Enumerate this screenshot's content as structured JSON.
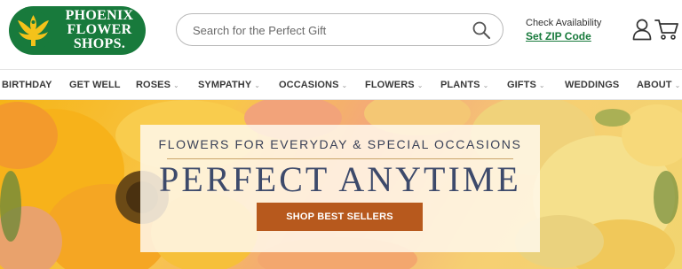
{
  "brand": {
    "logo_line1": "PHOENIX",
    "logo_line2": "FLOWER",
    "logo_line3": "SHOPS.",
    "green": "#187a3c"
  },
  "search": {
    "placeholder": "Search for the Perfect Gift",
    "icon": "search-icon"
  },
  "availability": {
    "label": "Check Availability",
    "link": "Set ZIP Code"
  },
  "header_icons": [
    "user-icon",
    "cart-icon"
  ],
  "nav": {
    "items": [
      {
        "label": "BIRTHDAY",
        "has_dropdown": false
      },
      {
        "label": "GET WELL",
        "has_dropdown": false
      },
      {
        "label": "ROSES",
        "has_dropdown": true
      },
      {
        "label": "SYMPATHY",
        "has_dropdown": true
      },
      {
        "label": "OCCASIONS",
        "has_dropdown": true
      },
      {
        "label": "FLOWERS",
        "has_dropdown": true
      },
      {
        "label": "PLANTS",
        "has_dropdown": true
      },
      {
        "label": "GIFTS",
        "has_dropdown": true
      },
      {
        "label": "WEDDINGS",
        "has_dropdown": false
      },
      {
        "label": "ABOUT",
        "has_dropdown": true
      }
    ],
    "dropdown_glyph": "⌄"
  },
  "hero": {
    "eyebrow": "FLOWERS FOR EVERYDAY & SPECIAL OCCASIONS",
    "title": "PERFECT ANYTIME",
    "cta": "SHOP BEST SELLERS",
    "cta_color": "#b7591d",
    "title_color": "#3d4a6b"
  }
}
